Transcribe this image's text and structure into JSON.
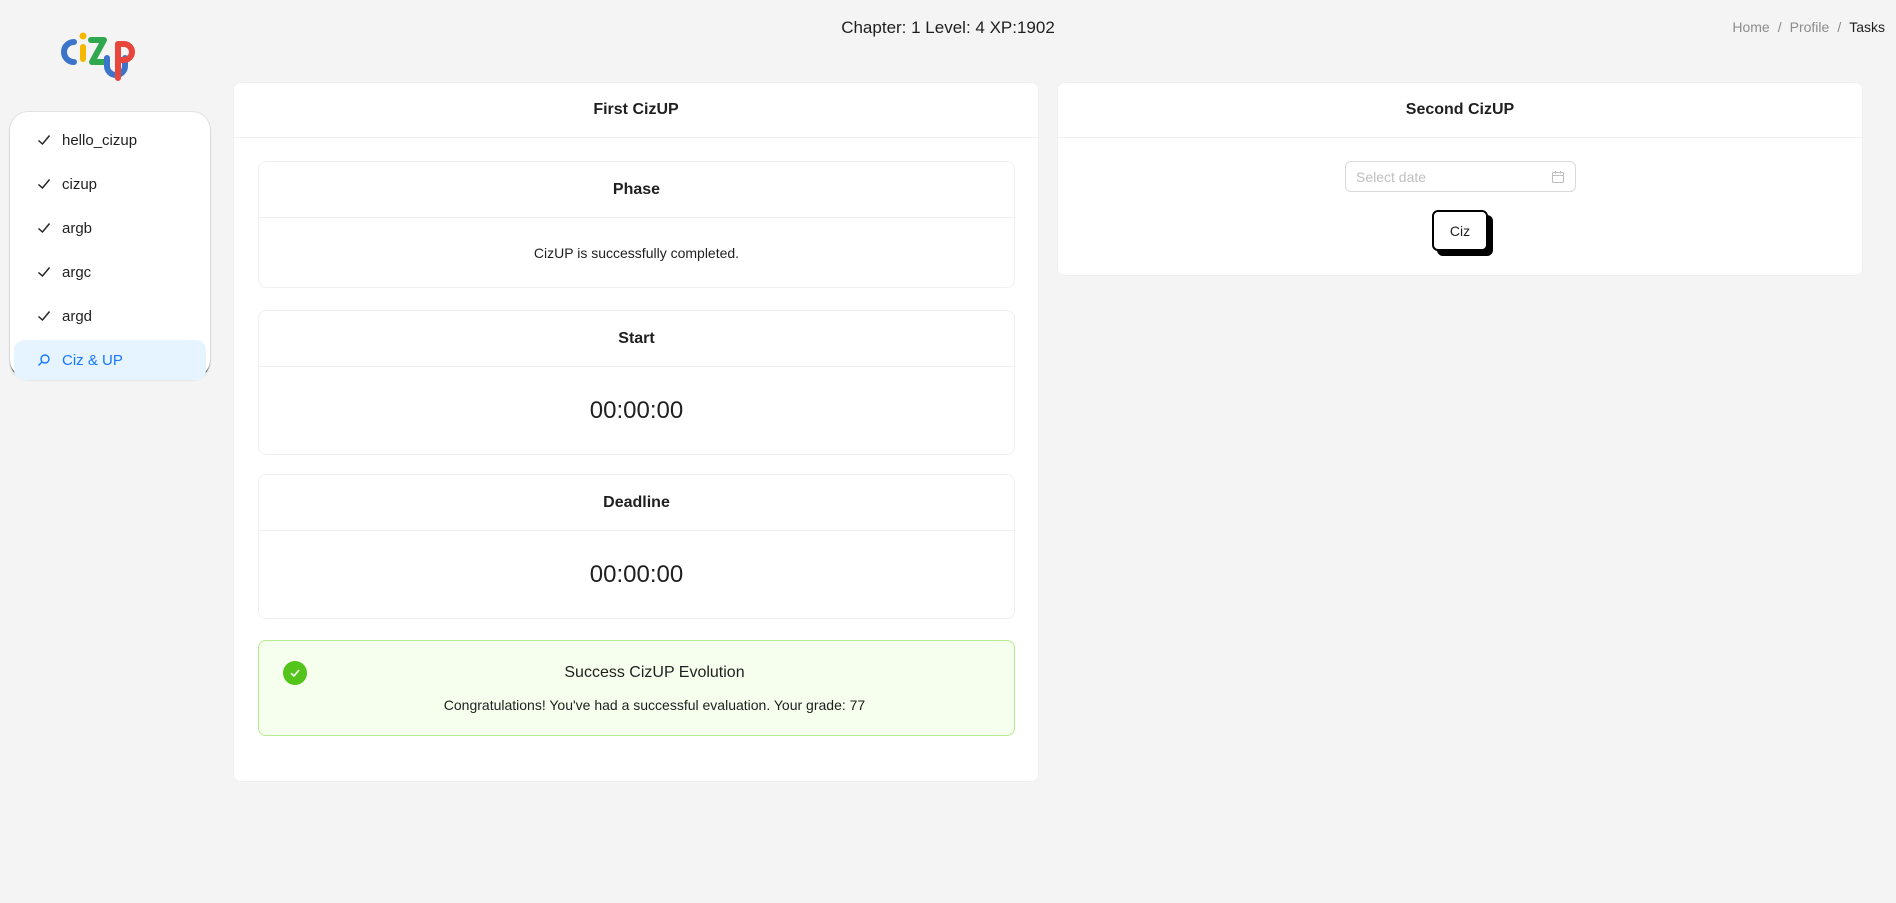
{
  "header": {
    "status": "Chapter: 1 Level: 4 XP:1902"
  },
  "breadcrumb": {
    "items": [
      "Home",
      "Profile",
      "Tasks"
    ],
    "separator": "/"
  },
  "sidebar": {
    "items": [
      {
        "label": "hello_cizup",
        "icon": "check-icon"
      },
      {
        "label": "cizup",
        "icon": "check-icon"
      },
      {
        "label": "argb",
        "icon": "check-icon"
      },
      {
        "label": "argc",
        "icon": "check-icon"
      },
      {
        "label": "argd",
        "icon": "check-icon"
      },
      {
        "label": "Ciz & UP",
        "icon": "search-icon",
        "active": true
      }
    ]
  },
  "first_card": {
    "title": "First CizUP",
    "phase": {
      "title": "Phase",
      "value": "CizUP is successfully completed."
    },
    "start": {
      "title": "Start",
      "value": "00:00:00"
    },
    "deadline": {
      "title": "Deadline",
      "value": "00:00:00"
    },
    "success": {
      "title": "Success CizUP Evolution",
      "message": "Congratulations! You've had a successful evaluation. Your grade: 77"
    }
  },
  "second_card": {
    "title": "Second CizUP",
    "date_placeholder": "Select date",
    "button_label": "Ciz"
  },
  "colors": {
    "background": "#f4f4f4",
    "active_item_bg": "#e6f4ff",
    "active_item_text": "#1677ff",
    "success_bg": "#f6ffed",
    "success_border": "#b7eb8f",
    "success_icon": "#52c41a"
  }
}
